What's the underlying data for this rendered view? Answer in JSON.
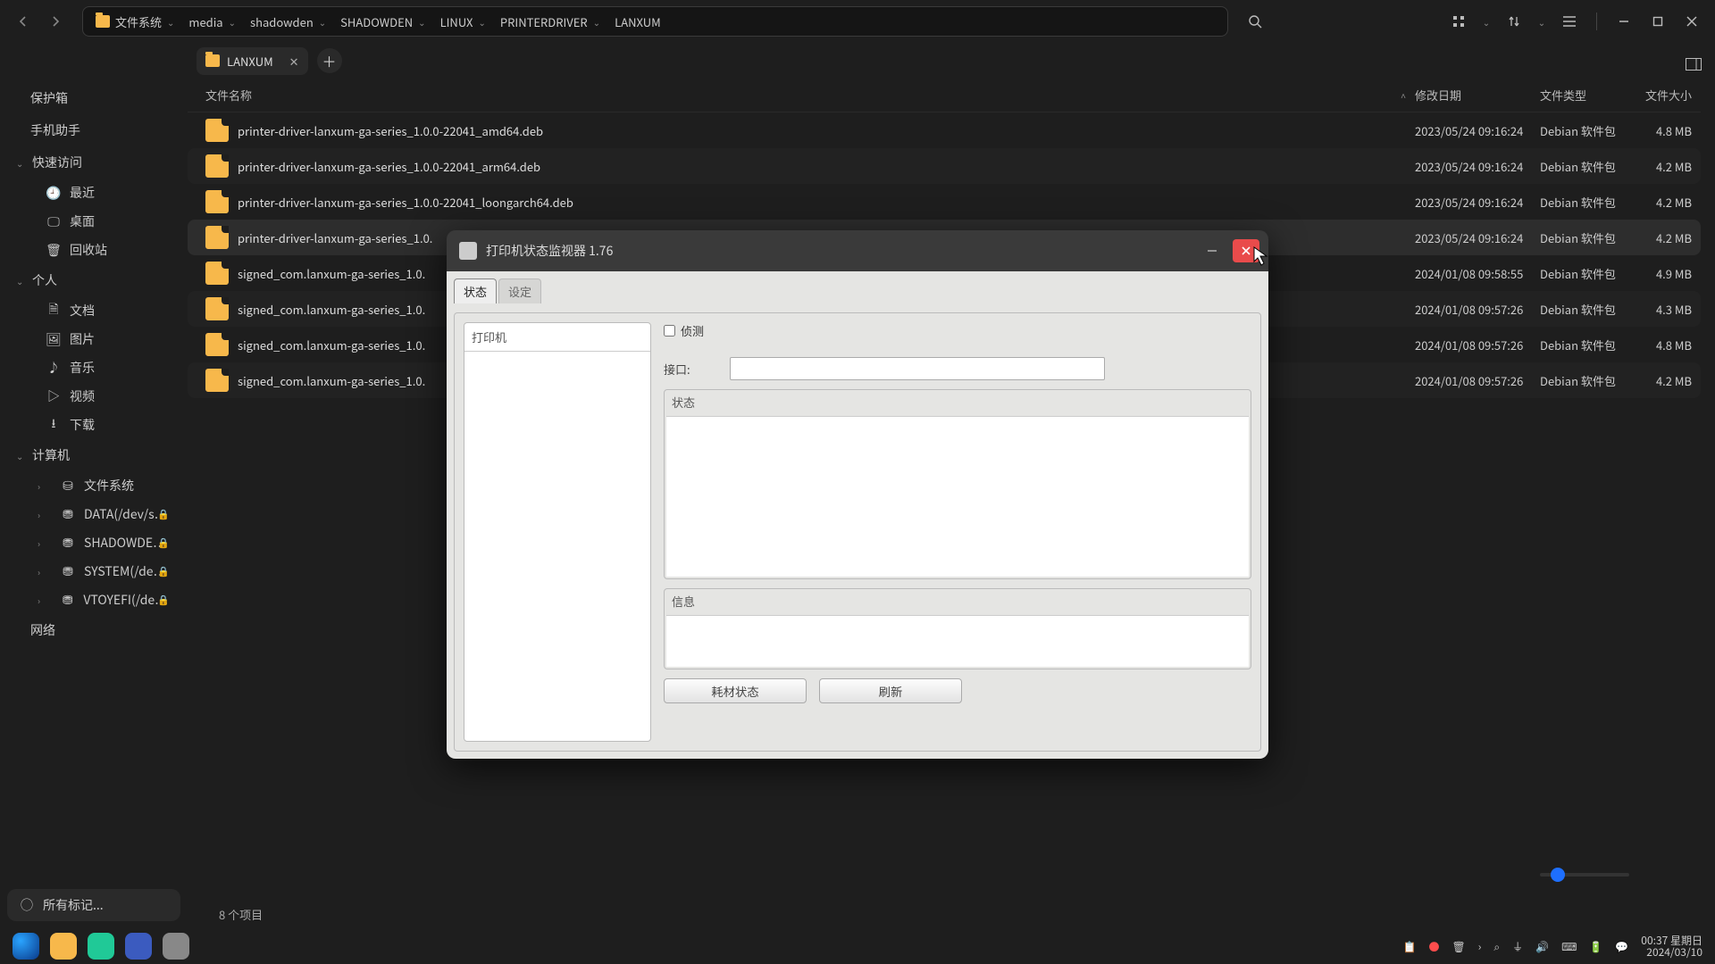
{
  "breadcrumb": {
    "root": "文件系统",
    "path": [
      "media",
      "shadowden",
      "SHADOWDEN",
      "LINUX",
      "PRINTERDRIVER",
      "LANXUM"
    ]
  },
  "tab": {
    "title": "LANXUM"
  },
  "columns": {
    "name": "文件名称",
    "date": "修改日期",
    "type": "文件类型",
    "size": "文件大小"
  },
  "sidebar": {
    "safebox": "保护箱",
    "mobile": "手机助手",
    "quick": "快速访问",
    "quick_items": [
      {
        "icon": "clock",
        "label": "最近"
      },
      {
        "icon": "monitor",
        "label": "桌面"
      },
      {
        "icon": "trash",
        "label": "回收站"
      }
    ],
    "personal": "个人",
    "personal_items": [
      {
        "icon": "doc",
        "label": "文档"
      },
      {
        "icon": "image",
        "label": "图片"
      },
      {
        "icon": "music",
        "label": "音乐"
      },
      {
        "icon": "video",
        "label": "视频"
      },
      {
        "icon": "download",
        "label": "下载"
      }
    ],
    "computer": "计算机",
    "computer_items": [
      {
        "label": "文件系统",
        "icon": "disk",
        "lock": false
      },
      {
        "label": "DATA(/dev/s…",
        "icon": "disk",
        "lock": true
      },
      {
        "label": "SHADOWDE…",
        "icon": "disk",
        "lock": true
      },
      {
        "label": "SYSTEM(/de…",
        "icon": "disk",
        "lock": true
      },
      {
        "label": "VTOYEFI(/de…",
        "icon": "disk",
        "lock": true
      }
    ],
    "network": "网络",
    "tags": "所有标记..."
  },
  "files": [
    {
      "name": "printer-driver-lanxum-ga-series_1.0.0-22041_amd64.deb",
      "date": "2023/05/24 09:16:24",
      "type": "Debian 软件包",
      "size": "4.8 MB"
    },
    {
      "name": "printer-driver-lanxum-ga-series_1.0.0-22041_arm64.deb",
      "date": "2023/05/24 09:16:24",
      "type": "Debian 软件包",
      "size": "4.2 MB"
    },
    {
      "name": "printer-driver-lanxum-ga-series_1.0.0-22041_loongarch64.deb",
      "date": "2023/05/24 09:16:24",
      "type": "Debian 软件包",
      "size": "4.2 MB"
    },
    {
      "name": "printer-driver-lanxum-ga-series_1.0.",
      "date": "2023/05/24 09:16:24",
      "type": "Debian 软件包",
      "size": "4.2 MB",
      "selected": true
    },
    {
      "name": "signed_com.lanxum-ga-series_1.0.",
      "date": "2024/01/08 09:58:55",
      "type": "Debian 软件包",
      "size": "4.9 MB"
    },
    {
      "name": "signed_com.lanxum-ga-series_1.0.",
      "date": "2024/01/08 09:57:26",
      "type": "Debian 软件包",
      "size": "4.3 MB"
    },
    {
      "name": "signed_com.lanxum-ga-series_1.0.",
      "date": "2024/01/08 09:57:26",
      "type": "Debian 软件包",
      "size": "4.8 MB"
    },
    {
      "name": "signed_com.lanxum-ga-series_1.0.",
      "date": "2024/01/08 09:57:26",
      "type": "Debian 软件包",
      "size": "4.2 MB"
    }
  ],
  "status": {
    "count": "8 个项目"
  },
  "dialog": {
    "title": "打印机状态监视器 1.76",
    "tabs": {
      "status": "状态",
      "settings": "设定"
    },
    "printer_label": "打印机",
    "detect": "侦测",
    "interface": "接口:",
    "status_group": "状态",
    "message_group": "信息",
    "btn_consumables": "耗材状态",
    "btn_refresh": "刷新"
  },
  "clock": {
    "time": "00:37",
    "weekday": "星期日",
    "date": "2024/03/10"
  },
  "tb_apps": [
    "launcher",
    "files",
    "mail",
    "terminal",
    "printer-monitor"
  ]
}
